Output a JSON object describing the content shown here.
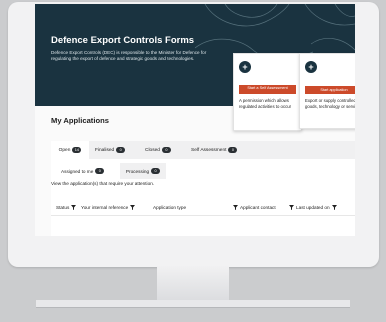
{
  "hero": {
    "title": "Defence Export Controls Forms",
    "description": "Defence Export Controls (DEC) is responsible to the Minister for Defence for regulating the export of defence and strategic goods and technologies."
  },
  "cards": [
    {
      "icon": "plus-icon",
      "button_label": "Start a Self Assessment",
      "description": "A permission which allows regulated activities to occur"
    },
    {
      "icon": "plus-icon",
      "button_label": "Start application",
      "description": "Export or supply controlled goods, technology or services"
    }
  ],
  "applications": {
    "title": "My Applications",
    "tabs": [
      {
        "label": "Open",
        "count": "14"
      },
      {
        "label": "Finalised",
        "count": "0"
      },
      {
        "label": "Closed",
        "count": "0"
      },
      {
        "label": "Self Assessment",
        "count": "0"
      }
    ],
    "subtabs": [
      {
        "label": "Assigned to me",
        "count": "0"
      },
      {
        "label": "Processing",
        "count": "0"
      }
    ],
    "hint": "View the application(s) that require your attention.",
    "columns": [
      "Status",
      "Your internal reference",
      "Application type",
      "Applicant contact",
      "Last updated on"
    ]
  },
  "colors": {
    "hero_bg": "#1a3340",
    "accent": "#cc4a2a",
    "badge": "#2a2f33"
  }
}
